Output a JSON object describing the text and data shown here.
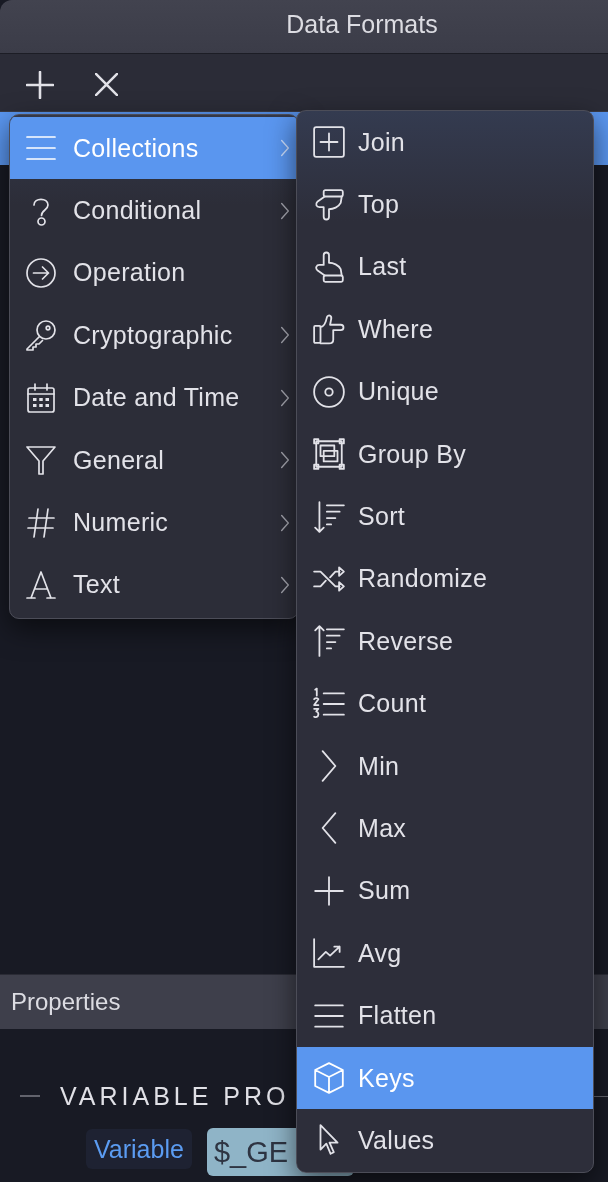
{
  "window": {
    "title": "Data Formats"
  },
  "toolbar": {
    "buttons": [
      {
        "kind": "add"
      },
      {
        "kind": "remove"
      }
    ]
  },
  "list": {
    "rows": [
      {
        "selected": true
      }
    ]
  },
  "menu": {
    "items": [
      {
        "label": "Collections",
        "selected": true,
        "has_submenu": true
      },
      {
        "label": "Conditional",
        "selected": false,
        "has_submenu": true
      },
      {
        "label": "Operation",
        "selected": false,
        "has_submenu": false
      },
      {
        "label": "Cryptographic",
        "selected": false,
        "has_submenu": true
      },
      {
        "label": "Date and Time",
        "selected": false,
        "has_submenu": true
      },
      {
        "label": "General",
        "selected": false,
        "has_submenu": true
      },
      {
        "label": "Numeric",
        "selected": false,
        "has_submenu": true
      },
      {
        "label": "Text",
        "selected": false,
        "has_submenu": true
      }
    ]
  },
  "submenu": {
    "items": [
      {
        "label": "Join",
        "selected": false
      },
      {
        "label": "Top",
        "selected": false
      },
      {
        "label": "Last",
        "selected": false
      },
      {
        "label": "Where",
        "selected": false
      },
      {
        "label": "Unique",
        "selected": false
      },
      {
        "label": "Group By",
        "selected": false
      },
      {
        "label": "Sort",
        "selected": false
      },
      {
        "label": "Randomize",
        "selected": false
      },
      {
        "label": "Reverse",
        "selected": false
      },
      {
        "label": "Count",
        "selected": false
      },
      {
        "label": "Min",
        "selected": false
      },
      {
        "label": "Max",
        "selected": false
      },
      {
        "label": "Sum",
        "selected": false
      },
      {
        "label": "Avg",
        "selected": false
      },
      {
        "label": "Flatten",
        "selected": false
      },
      {
        "label": "Keys",
        "selected": true
      },
      {
        "label": "Values",
        "selected": false
      }
    ]
  },
  "properties": {
    "header": "Properties",
    "section_title": "VARIABLE PRO",
    "tags": [
      {
        "kind": "type",
        "label": "Variable"
      },
      {
        "kind": "value",
        "label": "$_GE"
      }
    ]
  }
}
